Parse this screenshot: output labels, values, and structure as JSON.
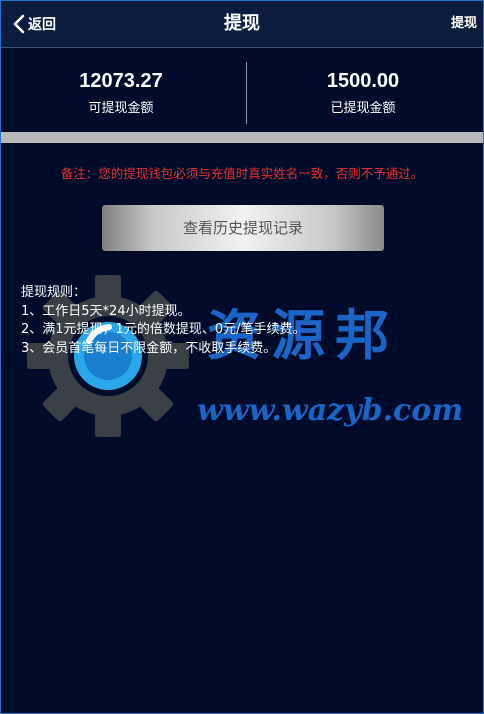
{
  "header": {
    "back_label": "返回",
    "title": "提现",
    "action_label": "提现"
  },
  "stats": {
    "withdrawable": {
      "value": "12073.27",
      "label": "可提现金额"
    },
    "withdrawn": {
      "value": "1500.00",
      "label": "已提现金额"
    }
  },
  "notice": "备注：您的提现钱包必须与充值时真实姓名一致，否则不予通过。",
  "history_button_label": "查看历史提现记录",
  "rules": {
    "title": "提现规则：",
    "items": [
      "1、工作日5天*24小时提现。",
      "2、满1元提现，1元的倍数提现、0元/笔手续费。",
      "3、会员首笔每日不限金额，不收取手续费。"
    ]
  },
  "watermark": {
    "brand": "资源邦",
    "url": "www.wazyb.com"
  },
  "colors": {
    "background": "#000c2a",
    "header_bg": "#0b1c3c",
    "notice_red": "#e83030",
    "watermark_blue": "#1d6fd8"
  }
}
